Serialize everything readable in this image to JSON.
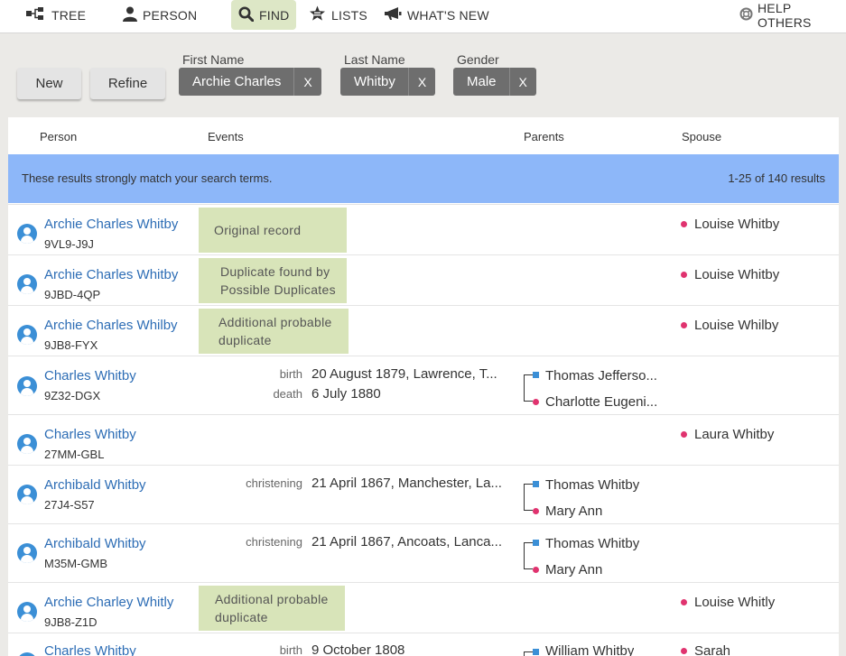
{
  "nav": {
    "tree": "TREE",
    "person": "PERSON",
    "find": "FIND",
    "lists": "LISTS",
    "whats_new": "WHAT'S NEW",
    "help": "HELP OTHERS"
  },
  "search": {
    "new_label": "New",
    "refine_label": "Refine",
    "first_name_label": "First Name",
    "first_name_value": "Archie Charles",
    "last_name_label": "Last Name",
    "last_name_value": "Whitby",
    "gender_label": "Gender",
    "gender_value": "Male",
    "clear_glyph": "X"
  },
  "columns": {
    "person": "Person",
    "events": "Events",
    "parents": "Parents",
    "spouse": "Spouse"
  },
  "results_banner": {
    "text": "These results strongly match your search terms.",
    "count": "1-25 of 140 results"
  },
  "rows": [
    {
      "name": "Archie Charles Whitby",
      "id": "9VL9-J9J",
      "tag": [
        "Original record"
      ],
      "spouse": "Louise Whitby"
    },
    {
      "name": "Archie Charles Whitby",
      "id": "9JBD-4QP",
      "tag": [
        "Duplicate found by",
        "Possible Duplicates"
      ],
      "spouse": "Louise Whitby"
    },
    {
      "name": "Archie Charles Whilby",
      "id": "9JB8-FYX",
      "tag": [
        "Additional probable",
        "duplicate"
      ],
      "spouse": "Louise Whilby"
    },
    {
      "name": "Charles Whitby",
      "id": "9Z32-DGX",
      "events": [
        {
          "type": "birth",
          "value": "20 August 1879, Lawrence, T..."
        },
        {
          "type": "death",
          "value": "6 July 1880"
        }
      ],
      "father": "Thomas Jefferso...",
      "mother": "Charlotte Eugeni..."
    },
    {
      "name": "Charles Whitby",
      "id": "27MM-GBL",
      "spouse": "Laura Whitby"
    },
    {
      "name": "Archibald Whitby",
      "id": "27J4-S57",
      "events": [
        {
          "type": "christening",
          "value": "21 April 1867, Manchester, La..."
        }
      ],
      "father": "Thomas Whitby",
      "mother": "Mary Ann"
    },
    {
      "name": "Archibald Whitby",
      "id": "M35M-GMB",
      "events": [
        {
          "type": "christening",
          "value": "21 April 1867, Ancoats, Lanca..."
        }
      ],
      "father": "Thomas Whitby",
      "mother": "Mary Ann"
    },
    {
      "name": "Archie Charley Whitly",
      "id": "9JB8-Z1D",
      "tag": [
        "Additional probable",
        "duplicate"
      ],
      "spouse": "Louise Whitly"
    },
    {
      "name": "Charles Whitby",
      "id": "",
      "events": [
        {
          "type": "birth",
          "value": "9 October 1808"
        }
      ],
      "father": "William Whitby",
      "spouse": "Sarah"
    }
  ]
}
